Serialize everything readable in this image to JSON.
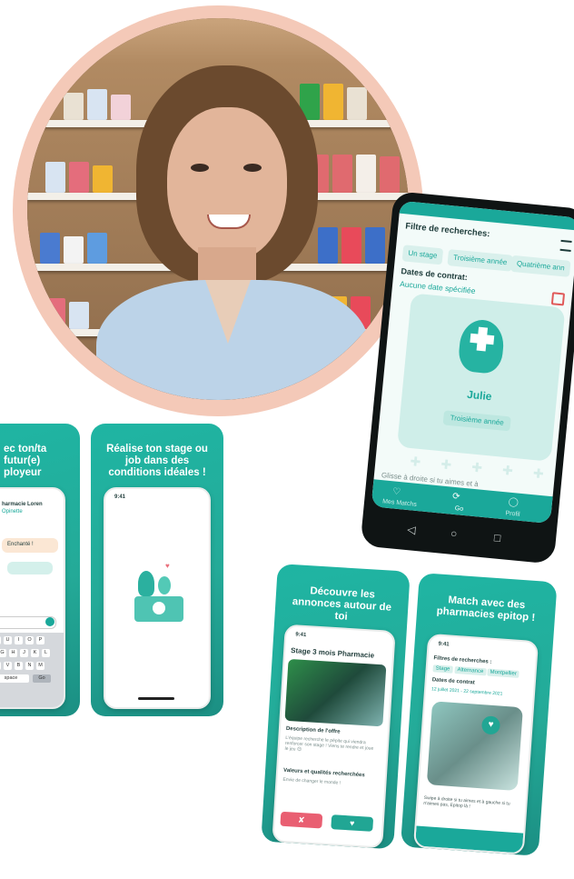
{
  "portrait": {
    "alt": "woman-in-pharmacy-photo"
  },
  "android_phone": {
    "filter_title": "Filtre de recherches:",
    "chips": [
      "Un stage",
      "Troisième année",
      "Quatrième ann"
    ],
    "contract_title": "Dates de contrat:",
    "contract_value": "Aucune date spécifiée",
    "profile_name": "Julie",
    "profile_badge": "Troisième année",
    "swipe_hint": "Glisse à droite si tu aimes et à",
    "tabs": [
      "Mes Matchs",
      "Go",
      "Profil"
    ]
  },
  "screen_chat": {
    "caption": "ec ton/ta futur(e) ployeur",
    "contact_name": "harmacie Loren",
    "contact_sub": "Opinette",
    "message": "Enchanté !",
    "input_value": "ller",
    "keys_row1": [
      "T",
      "Y",
      "U",
      "I",
      "O",
      "P"
    ],
    "keys_row2": [
      "F",
      "G",
      "H",
      "J",
      "K",
      "L"
    ],
    "keys_row3": [
      "C",
      "V",
      "B",
      "N",
      "M"
    ],
    "space_key": "space",
    "go_key": "Go"
  },
  "screen_welcome": {
    "caption": "Réalise ton stage ou job dans des conditions idéales !",
    "time": "9:41"
  },
  "screen_offers": {
    "caption": "Découvre les annonces autour de toi",
    "time": "9:41",
    "offer_title": "Stage 3 mois Pharmacie",
    "desc_title": "Description de l'offre",
    "desc_body": "L'équipe recherche le pépite qui viendra renforcer son stage ! Viens te rendre et joue le jeu 😊",
    "values_title": "Valeurs et qualités recherchées",
    "values_body": "Envie de changer le monde !"
  },
  "screen_match": {
    "caption": "Match avec des pharmacies epitop !",
    "time": "9:41",
    "filter_title": "Filtres de recherches :",
    "chips": [
      "Stage",
      "Alternance",
      "Montpellier"
    ],
    "contract_title": "Dates de contrat",
    "contract_value": "12 juillet 2021 - 22 septembre 2021",
    "hint": "Swipe à droite si tu aimes et à gauche si tu n'aimes pas, Epitop là !"
  }
}
